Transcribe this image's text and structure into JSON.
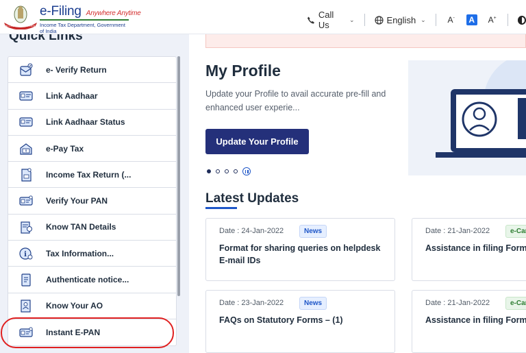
{
  "header": {
    "brand_title": "e-Filing",
    "brand_tagline": "Anywhere Anytime",
    "brand_subtitle": "Income Tax Department, Government of India",
    "call_us": "Call Us",
    "language": "English",
    "font_decrease": "A",
    "font_default": "A",
    "font_increase": "A"
  },
  "sidebar": {
    "heading": "Quick Links",
    "items": [
      {
        "label": "e- Verify Return",
        "icon": "verify-return-icon"
      },
      {
        "label": "Link Aadhaar",
        "icon": "aadhaar-card-icon"
      },
      {
        "label": "Link Aadhaar Status",
        "icon": "aadhaar-status-icon"
      },
      {
        "label": "e-Pay Tax",
        "icon": "pay-tax-icon"
      },
      {
        "label": "Income Tax Return (...",
        "icon": "itr-document-icon"
      },
      {
        "label": "Verify Your PAN",
        "icon": "pan-card-icon"
      },
      {
        "label": "Know TAN Details",
        "icon": "tan-details-icon"
      },
      {
        "label": "Tax Information...",
        "icon": "info-icon"
      },
      {
        "label": "Authenticate notice...",
        "icon": "notice-icon"
      },
      {
        "label": "Know Your AO",
        "icon": "ao-icon"
      },
      {
        "label": "Instant E-PAN",
        "icon": "epan-card-icon"
      }
    ]
  },
  "profile": {
    "title": "My Profile",
    "description": "Update your Profile to avail accurate pre-fill and enhanced user experie...",
    "button_label": "Update Your Profile",
    "carousel_slides": 4,
    "carousel_active": 1
  },
  "updates": {
    "title": "Latest Updates",
    "cards": [
      {
        "date": "Date : 24-Jan-2022",
        "badge": "News",
        "text": "Format for sharing queries on helpdesk E-mail IDs"
      },
      {
        "date": "Date : 21-Jan-2022",
        "badge": "e-Car",
        "text": "Assistance in filing Form"
      },
      {
        "date": "Date : 23-Jan-2022",
        "badge": "News",
        "text": "FAQs on Statutory Forms – (1)"
      },
      {
        "date": "Date : 21-Jan-2022",
        "badge": "e-Car",
        "text": "Assistance in filing Form"
      }
    ]
  },
  "colors": {
    "primary_button": "#24307a",
    "accent_blue": "#1e56c8",
    "highlight_red": "#e02020",
    "sidebar_bg": "#eef1f8"
  }
}
